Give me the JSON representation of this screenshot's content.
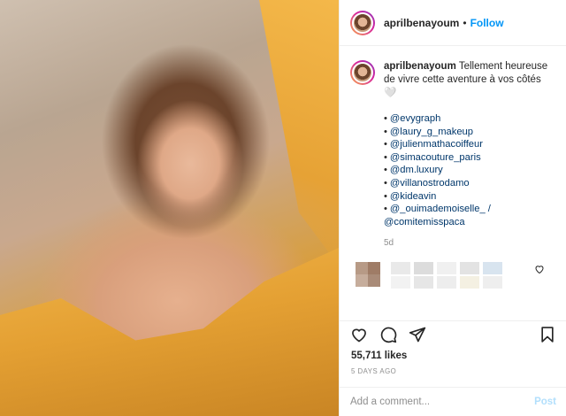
{
  "post": {
    "username": "aprilbenayoum",
    "follow_label": "Follow",
    "caption_user": "aprilbenayoum",
    "caption_text": "Tellement heureuse de vivre cette aventure à vos côtés 🤍",
    "mentions": [
      "@evygraph",
      "@laury_g_makeup",
      "@julienmathacoiffeur",
      "@simacouture_paris",
      "@dm.luxury",
      "@villanostrodamo",
      "@kideavin",
      "@_ouimademoiselle_ /",
      "@comitemisspaca"
    ],
    "caption_age": "5d",
    "likes": "55,711 likes",
    "posted_ago": "5 DAYS AGO",
    "comment_placeholder": "Add a comment...",
    "post_label": "Post"
  },
  "icons": {
    "heart": "heart-icon",
    "comment": "comment-icon",
    "share": "share-icon",
    "bookmark": "bookmark-icon"
  },
  "colors": {
    "link": "#00376b",
    "follow": "#0095f6",
    "muted": "#8e8e8e"
  }
}
